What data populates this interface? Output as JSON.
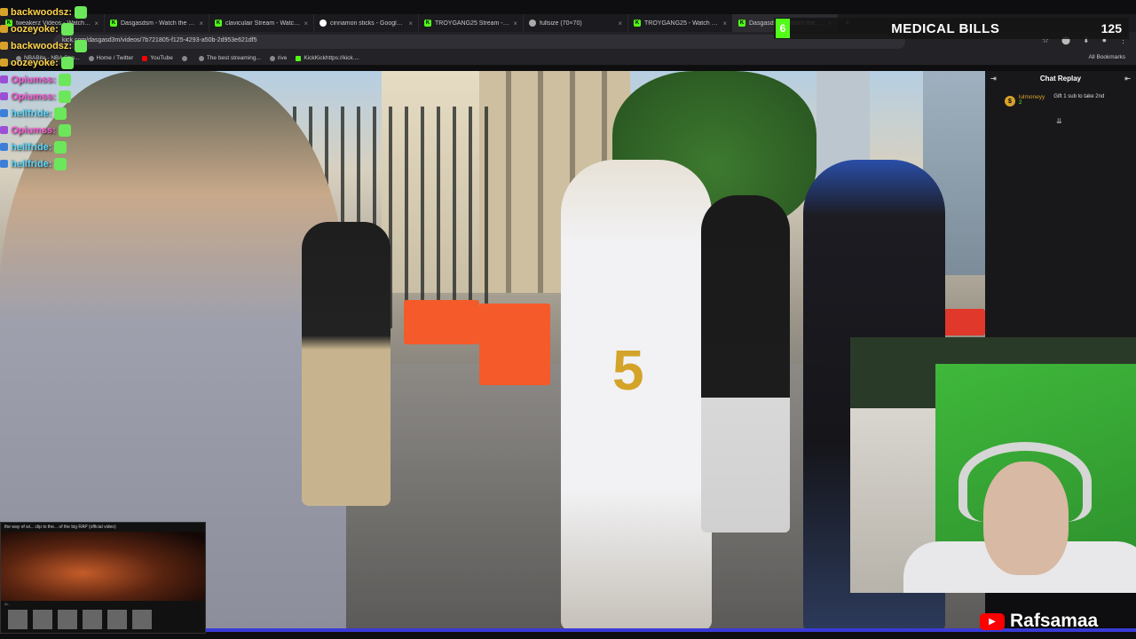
{
  "browser": {
    "tabs": [
      {
        "title": "tweakerz Videos - Watch On...",
        "favicon": "k"
      },
      {
        "title": "Dasgasdsm - Watch the VOD ...",
        "favicon": "k"
      },
      {
        "title": "claviculair Stream - Watch Live ...",
        "favicon": "k"
      },
      {
        "title": "cinnamon sticks - Google Sear...",
        "favicon": "g"
      },
      {
        "title": "TROYGANG25 Stream - Watch ...",
        "favicon": "k"
      },
      {
        "title": "fullsize (70×70)",
        "favicon": "w"
      },
      {
        "title": "TROYGANG25 - Watch clips o...",
        "favicon": "k"
      },
      {
        "title": "Dasgasdsm - Watch the VOD ...",
        "favicon": "k"
      }
    ],
    "new_tab": "+",
    "url": "kick.com/dasgasd3m/videos/7b721805-f125-4293-a50b-2d953e621df5",
    "bookmarks": [
      {
        "label": "NBABite - NBA Stre...",
        "icon": "globe"
      },
      {
        "label": "Home / Twitter",
        "icon": "x"
      },
      {
        "label": "YouTube",
        "icon": "yt"
      },
      {
        "label": "",
        "icon": "globe"
      },
      {
        "label": "The best streaming...",
        "icon": "globe"
      },
      {
        "label": "rive",
        "icon": "globe"
      },
      {
        "label": "KickKickhttps://kick....",
        "icon": "k"
      }
    ],
    "all_bookmarks": "All Bookmarks"
  },
  "chat_overlay": [
    {
      "user": "backwoodsz:",
      "color": "yellow"
    },
    {
      "user": "oozeyoke:",
      "color": "yellow"
    },
    {
      "user": "backwoodsz:",
      "color": "yellow"
    },
    {
      "user": "oozeyoke:",
      "color": "yellow"
    },
    {
      "user": "Opiumss:",
      "color": "pink"
    },
    {
      "user": "Opiumss:",
      "color": "pink"
    },
    {
      "user": "hellfride:",
      "color": "cyan"
    },
    {
      "user": "Opiumss:",
      "color": "pink"
    },
    {
      "user": "hellfride:",
      "color": "cyan"
    },
    {
      "user": "hellfride:",
      "color": "cyan"
    }
  ],
  "banner": {
    "badge": "6",
    "text": "MEDICAL BILLS",
    "count": "125"
  },
  "chat_replay": {
    "title": "Chat Replay",
    "user": "lulmoneyy",
    "message": "Gift 1 sub to take 2nd",
    "badge_num": "2"
  },
  "mini_player": {
    "title": "the way of wi... clip to the... of the big RAP (official video)",
    "caption": "Al..."
  },
  "progress": {
    "fraction": 1.0
  },
  "watermark": {
    "channel": "Rafsamaa"
  }
}
